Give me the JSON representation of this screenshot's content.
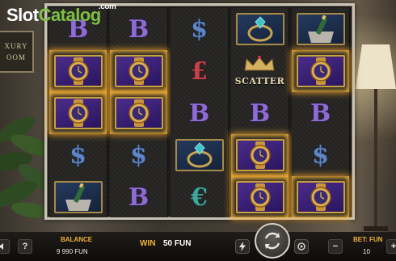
{
  "branding": {
    "watermark_slot": "Slot",
    "watermark_catalog": "Catalog",
    "watermark_com": ".com",
    "room_sign_line1": "XURY",
    "room_sign_line2": "OOM"
  },
  "reels": [
    [
      {
        "symbol": "bitcoin",
        "glyph": "B",
        "win": false
      },
      {
        "symbol": "gold-watch",
        "glyph": "",
        "win": true
      },
      {
        "symbol": "gold-watch",
        "glyph": "",
        "win": true
      },
      {
        "symbol": "dollar",
        "glyph": "$",
        "win": false
      },
      {
        "symbol": "champagne",
        "glyph": "",
        "win": false
      }
    ],
    [
      {
        "symbol": "bitcoin",
        "glyph": "B",
        "win": false
      },
      {
        "symbol": "gold-watch",
        "glyph": "",
        "win": true
      },
      {
        "symbol": "gold-watch",
        "glyph": "",
        "win": true
      },
      {
        "symbol": "dollar",
        "glyph": "$",
        "win": false
      },
      {
        "symbol": "bitcoin",
        "glyph": "B",
        "win": false
      }
    ],
    [
      {
        "symbol": "dollar",
        "glyph": "$",
        "win": false
      },
      {
        "symbol": "pound",
        "glyph": "£",
        "win": false
      },
      {
        "symbol": "bitcoin",
        "glyph": "B",
        "win": false
      },
      {
        "symbol": "diamond-ring",
        "glyph": "",
        "win": false
      },
      {
        "symbol": "euro",
        "glyph": "€",
        "win": false
      }
    ],
    [
      {
        "symbol": "diamond-ring",
        "glyph": "",
        "win": false
      },
      {
        "symbol": "scatter-crown",
        "glyph": "",
        "win": false
      },
      {
        "symbol": "bitcoin",
        "glyph": "B",
        "win": false
      },
      {
        "symbol": "gold-watch",
        "glyph": "",
        "win": true
      },
      {
        "symbol": "gold-watch",
        "glyph": "",
        "win": true
      }
    ],
    [
      {
        "symbol": "champagne",
        "glyph": "",
        "win": false
      },
      {
        "symbol": "gold-watch",
        "glyph": "",
        "win": true
      },
      {
        "symbol": "bitcoin",
        "glyph": "B",
        "win": false
      },
      {
        "symbol": "dollar",
        "glyph": "$",
        "win": false
      },
      {
        "symbol": "gold-watch",
        "glyph": "",
        "win": true
      }
    ]
  ],
  "scatter_label": "SCATTER",
  "bottom_bar": {
    "info_label": "?",
    "balance_label": "BALANCE",
    "balance_value": "9 990 FUN",
    "win_label": "WIN",
    "win_value": "50 FUN",
    "bet_label": "BET: FUN",
    "bet_value": "10",
    "minus_label": "−",
    "plus_label": "+"
  },
  "colors": {
    "accent": "#f2b13a",
    "win_glow": "#ffbe3c",
    "watermark_green": "#7cc142"
  }
}
